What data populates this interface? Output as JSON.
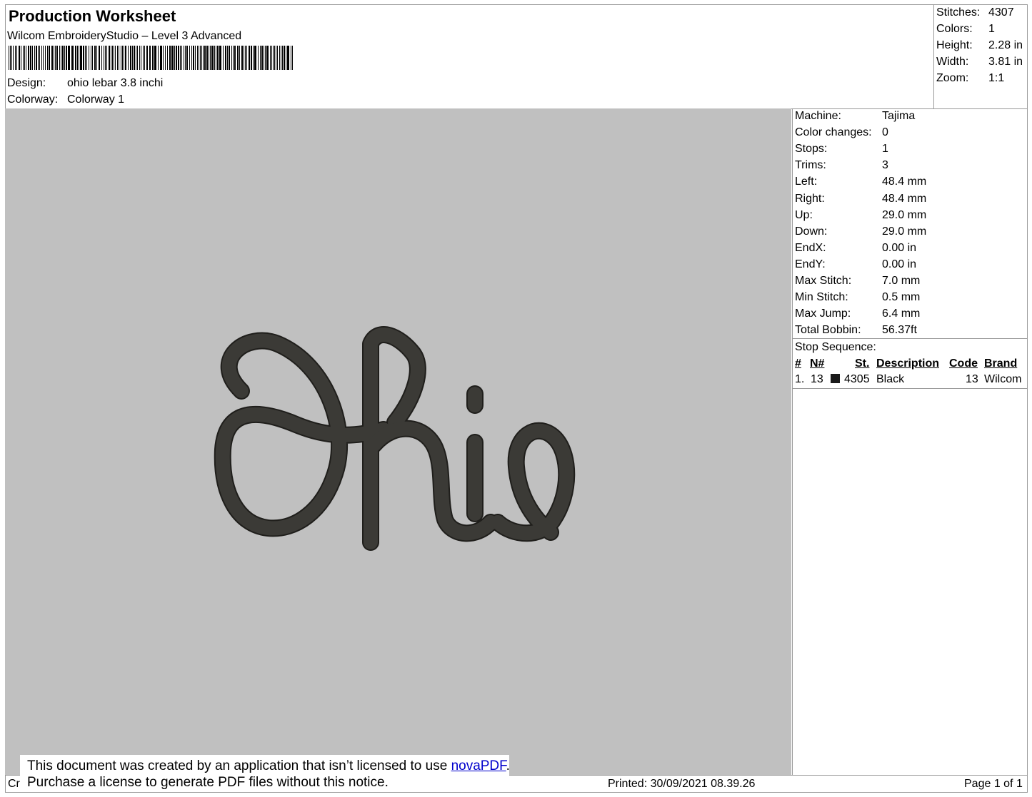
{
  "header": {
    "title": "Production Worksheet",
    "software": "Wilcom EmbroideryStudio – Level 3 Advanced",
    "design_label": "Design:",
    "design_value": "ohio lebar 3.8 inchi",
    "colorway_label": "Colorway:",
    "colorway_value": "Colorway 1"
  },
  "summary": [
    {
      "label": "Stitches:",
      "value": "4307"
    },
    {
      "label": "Colors:",
      "value": "1"
    },
    {
      "label": "Height:",
      "value": "2.28 in"
    },
    {
      "label": "Width:",
      "value": "3.81 in"
    },
    {
      "label": "Zoom:",
      "value": "1:1"
    }
  ],
  "details": [
    {
      "label": "Machine:",
      "value": "Tajima"
    },
    {
      "label": "Color changes:",
      "value": "0"
    },
    {
      "label": "Stops:",
      "value": "1"
    },
    {
      "label": "Trims:",
      "value": "3"
    },
    {
      "label": "Left:",
      "value": "48.4 mm"
    },
    {
      "label": "Right:",
      "value": "48.4 mm"
    },
    {
      "label": "Up:",
      "value": "29.0 mm"
    },
    {
      "label": "Down:",
      "value": "29.0 mm"
    },
    {
      "label": "EndX:",
      "value": "0.00 in"
    },
    {
      "label": "EndY:",
      "value": "0.00 in"
    },
    {
      "label": "Max Stitch:",
      "value": "7.0 mm"
    },
    {
      "label": "Min Stitch:",
      "value": "0.5 mm"
    },
    {
      "label": "Max Jump:",
      "value": "6.4 mm"
    },
    {
      "label": "Total Bobbin:",
      "value": "56.37ft"
    }
  ],
  "stop_sequence": {
    "label": "Stop Sequence:",
    "headers": {
      "num": "#",
      "n": "N#",
      "st": "St.",
      "description": "Description",
      "code": "Code",
      "brand": "Brand"
    },
    "rows": [
      {
        "num": "1.",
        "n": "13",
        "color": "#1a1a1a",
        "st": "4305",
        "description": "Black",
        "code": "13",
        "brand": "Wilcom"
      }
    ]
  },
  "footer": {
    "left_fragment": "Cr",
    "printed": "Printed: 30/09/2021 08.39.26",
    "page": "Page 1 of 1"
  },
  "notice": {
    "line1_prefix": "This document was created by an application that isn’t licensed to use ",
    "link": "novaPDF",
    "line1_suffix": ".",
    "line2": "Purchase a license to generate PDF files without this notice."
  },
  "design_preview": {
    "text": "Ohio",
    "thread_color": "#3b3a36",
    "background_color": "#c0c0c0"
  }
}
